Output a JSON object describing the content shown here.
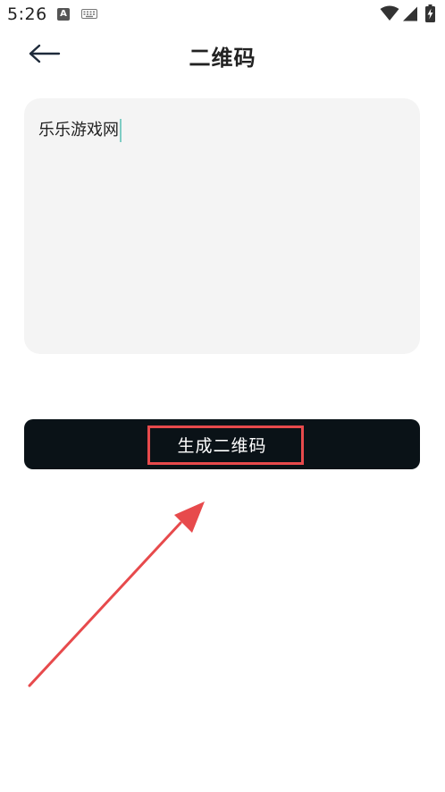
{
  "status_bar": {
    "time": "5:26",
    "a_badge": "A",
    "icons": [
      "a-icon",
      "keyboard-icon",
      "wifi-icon",
      "signal-icon",
      "battery-charging-icon"
    ]
  },
  "header": {
    "back_icon": "arrow-left-icon",
    "title": "二维码"
  },
  "input": {
    "value": "乐乐游戏网",
    "background": "#f4f4f4",
    "cursor_color": "#7fcdc4"
  },
  "generate_button": {
    "label": "生成二维码",
    "background": "#0a1217"
  },
  "annotation": {
    "color": "#e74a4c"
  }
}
